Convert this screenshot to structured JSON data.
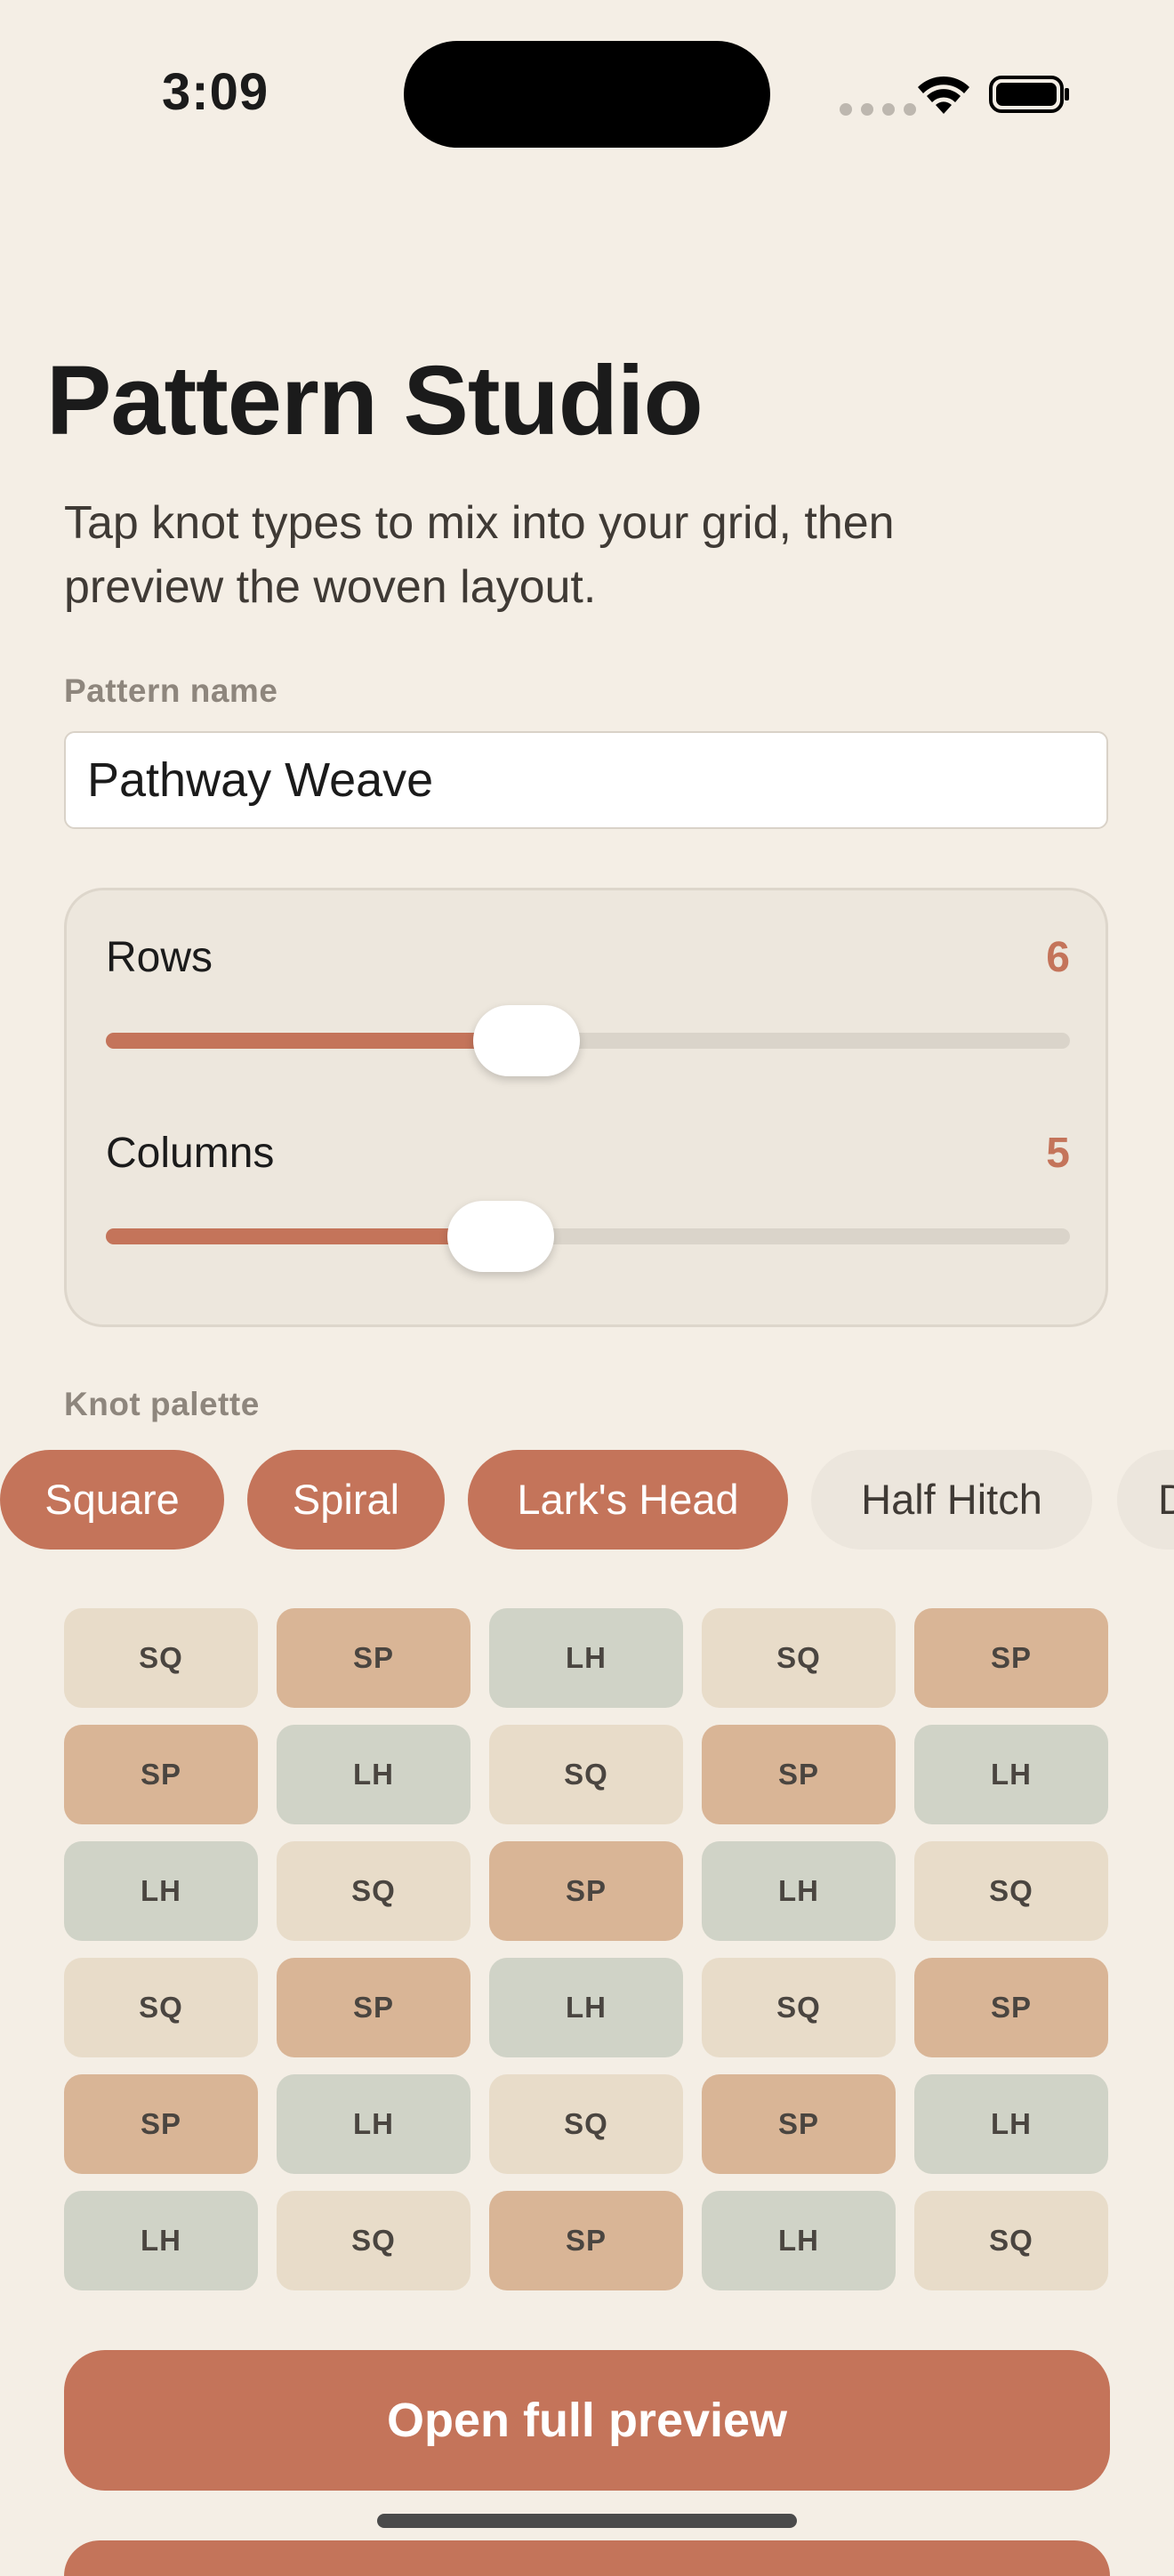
{
  "status_bar": {
    "time": "3:09",
    "icons": [
      "cellular-dots-icon",
      "wifi-icon",
      "battery-icon"
    ]
  },
  "header": {
    "title": "Pattern Studio",
    "subtitle": "Tap knot types to mix into your grid, then preview the woven layout."
  },
  "pattern_name": {
    "label": "Pattern name",
    "value": "Pathway Weave"
  },
  "sliders": {
    "rows": {
      "label": "Rows",
      "value": "6",
      "fraction": 0.436
    },
    "columns": {
      "label": "Columns",
      "value": "5",
      "fraction": 0.41
    }
  },
  "palette": {
    "label": "Knot palette",
    "chips": [
      {
        "label": "Square",
        "selected": true
      },
      {
        "label": "Spiral",
        "selected": true
      },
      {
        "label": "Lark's Head",
        "selected": true
      },
      {
        "label": "Half Hitch",
        "selected": false
      },
      {
        "label": "D",
        "selected": false
      }
    ]
  },
  "grid": {
    "rows": [
      [
        "SQ",
        "SP",
        "LH",
        "SQ",
        "SP"
      ],
      [
        "SP",
        "LH",
        "SQ",
        "SP",
        "LH"
      ],
      [
        "LH",
        "SQ",
        "SP",
        "LH",
        "SQ"
      ],
      [
        "SQ",
        "SP",
        "LH",
        "SQ",
        "SP"
      ],
      [
        "SP",
        "LH",
        "SQ",
        "SP",
        "LH"
      ],
      [
        "LH",
        "SQ",
        "SP",
        "LH",
        "SQ"
      ]
    ]
  },
  "actions": {
    "preview_label": "Open full preview"
  },
  "colors": {
    "accent": "#C4745A",
    "background": "#F4EEE5",
    "square": "#E8DCC9",
    "spiral": "#D9B596",
    "larks_head": "#D0D3C7"
  }
}
